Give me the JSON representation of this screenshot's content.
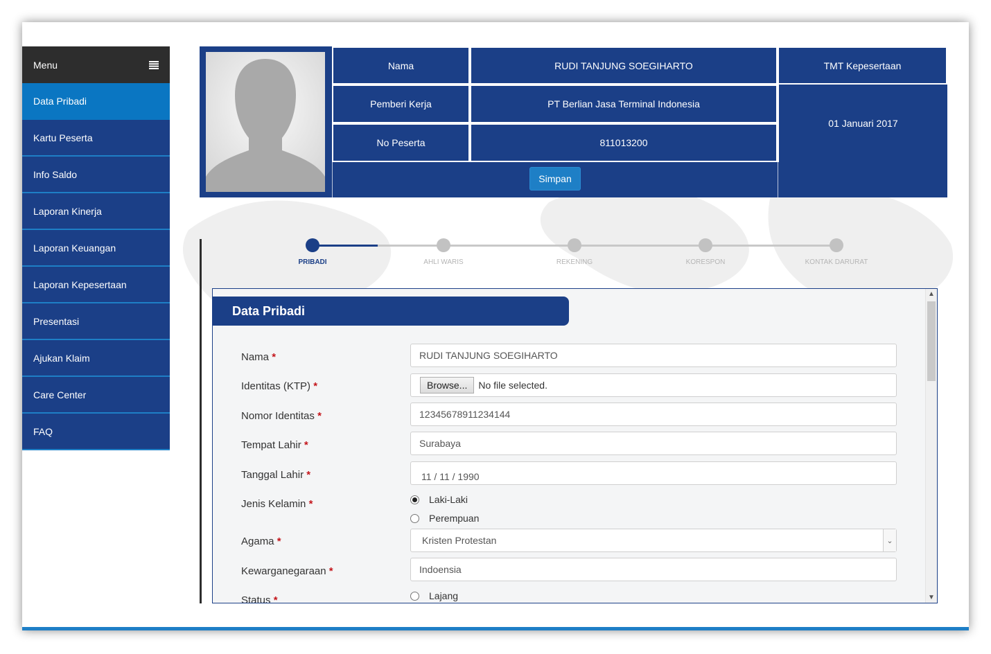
{
  "sidebar": {
    "menu_label": "Menu",
    "items": [
      {
        "label": "Data Pribadi",
        "active": true
      },
      {
        "label": "Kartu Peserta"
      },
      {
        "label": "Info Saldo"
      },
      {
        "label": "Laporan Kinerja"
      },
      {
        "label": "Laporan Keuangan"
      },
      {
        "label": "Laporan Kepesertaan"
      },
      {
        "label": "Presentasi"
      },
      {
        "label": "Ajukan Klaim"
      },
      {
        "label": "Care Center"
      },
      {
        "label": "FAQ"
      }
    ]
  },
  "header": {
    "nama_label": "Nama",
    "nama_value": "RUDI TANJUNG SOEGIHARTO",
    "pemberi_label": "Pemberi Kerja",
    "pemberi_value": "PT Berlian Jasa Terminal Indonesia",
    "no_label": "No Peserta",
    "no_value": "811013200",
    "tmt_label": "TMT Kepesertaan",
    "tmt_value": "01 Januari 2017",
    "save_label": "Simpan"
  },
  "stepper": {
    "steps": [
      "PRIBADI",
      "AHLI WARIS",
      "REKENING",
      "KORESPON",
      "KONTAK DARURAT"
    ],
    "active_index": 0
  },
  "form": {
    "title": "Data Pribadi",
    "nama": {
      "label": "Nama",
      "value": "RUDI TANJUNG SOEGIHARTO"
    },
    "identitas": {
      "label": "Identitas (KTP)",
      "browse_label": "Browse...",
      "file_status": "No file selected."
    },
    "nomor": {
      "label": "Nomor Identitas",
      "value": "12345678911234144"
    },
    "tempat": {
      "label": "Tempat Lahir",
      "value": "Surabaya"
    },
    "tanggal": {
      "label": "Tanggal Lahir",
      "value": "11 / 11 / 1990"
    },
    "kelamin": {
      "label": "Jenis Kelamin",
      "options": [
        "Laki-Laki",
        "Perempuan"
      ],
      "selected": "Laki-Laki"
    },
    "agama": {
      "label": "Agama",
      "value": "Kristen Protestan"
    },
    "kewarganegaraan": {
      "label": "Kewarganegaraan",
      "value": "Indoensia"
    },
    "status": {
      "label": "Status",
      "first_option": "Lajang"
    },
    "required_mark": "*"
  },
  "colors": {
    "primary": "#1b3f87",
    "accent": "#0a76c2",
    "sidebar_head": "#2d2d2d"
  }
}
